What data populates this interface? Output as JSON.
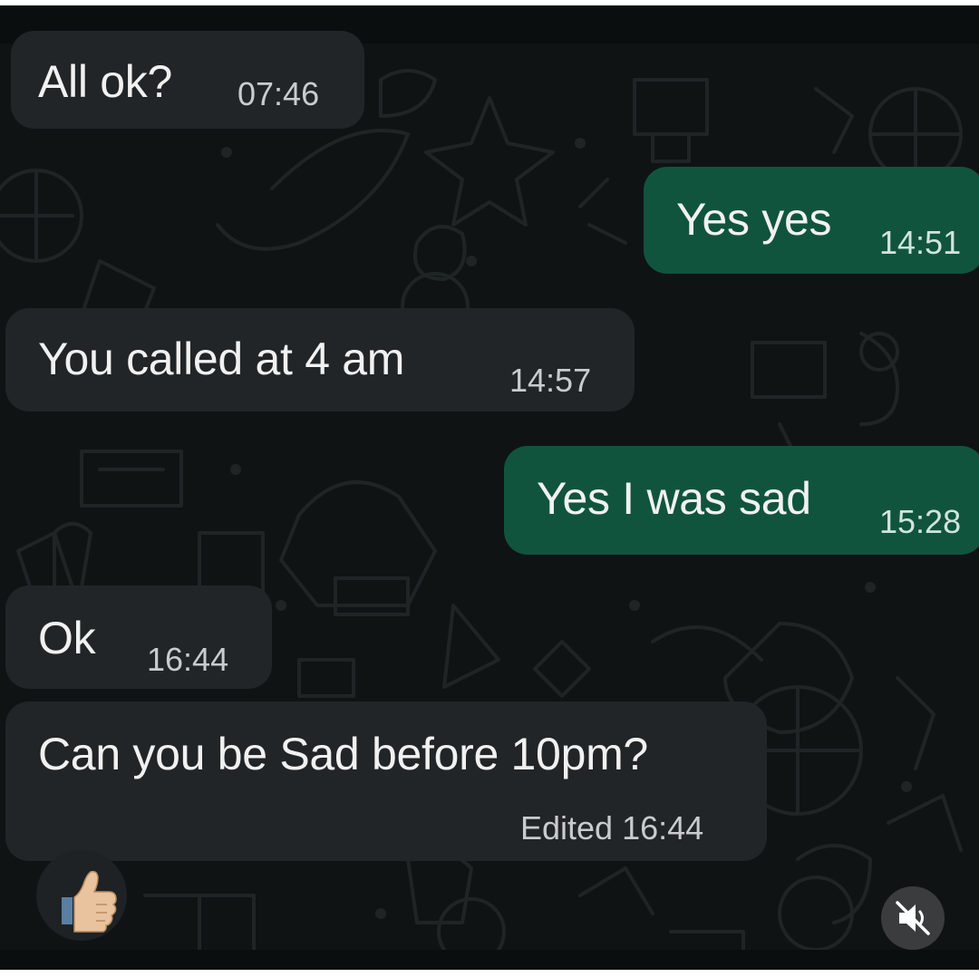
{
  "messages": [
    {
      "text": "All ok?",
      "time": "07:46",
      "direction": "incoming"
    },
    {
      "text": "Yes yes",
      "time": "14:51",
      "direction": "outgoing"
    },
    {
      "text": "You called at 4 am",
      "time": "14:57",
      "direction": "incoming"
    },
    {
      "text": "Yes I was sad",
      "time": "15:28",
      "direction": "outgoing"
    },
    {
      "text": "Ok",
      "time": "16:44",
      "direction": "incoming"
    },
    {
      "text": "Can you be Sad before 10pm?",
      "time": "Edited 16:44",
      "direction": "incoming"
    }
  ],
  "reaction": {
    "emoji": "👍",
    "icon": "thumbs-up-icon"
  },
  "video_control": {
    "icon": "mute-icon",
    "state": "muted"
  },
  "colors": {
    "incoming_bubble": "#222527",
    "outgoing_bubble": "#11543e",
    "chat_background": "#101314",
    "text": "#f1f1f1"
  }
}
